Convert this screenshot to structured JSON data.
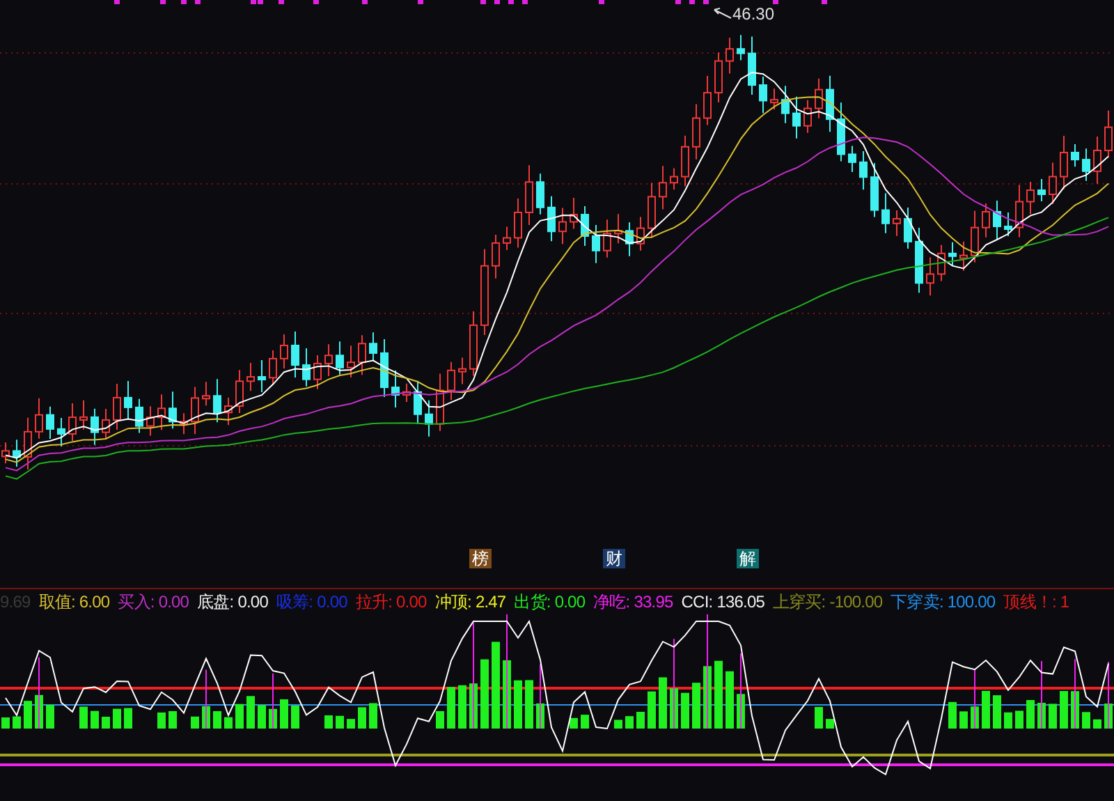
{
  "main_chart": {
    "high_label": "46.30"
  },
  "badges": [
    {
      "text": "榜",
      "color": "#7a4a1a"
    },
    {
      "text": "财",
      "color": "#1a3a6a"
    },
    {
      "text": "解",
      "color": "#0f6e6e"
    }
  ],
  "legend": [
    {
      "value": "9.69",
      "color": "#3a3a3a"
    },
    {
      "label": "取值:",
      "value": "6.00",
      "color": "#d8c030"
    },
    {
      "label": "买入:",
      "value": "0.00",
      "color": "#c030c8"
    },
    {
      "label": "底盘:",
      "value": "0.00",
      "color": "#f0f0f0"
    },
    {
      "label": "吸筹:",
      "value": "0.00",
      "color": "#1a2ee8"
    },
    {
      "label": "拉升:",
      "value": "0.00",
      "color": "#e81a1a"
    },
    {
      "label": "冲顶:",
      "value": "2.47",
      "color": "#f0f020"
    },
    {
      "label": "出货:",
      "value": "0.00",
      "color": "#20e820"
    },
    {
      "label": "净吃:",
      "value": "33.95",
      "color": "#f020f0"
    },
    {
      "label": "CCI:",
      "value": "136.05",
      "color": "#f0f0f0"
    },
    {
      "label": "上穿买:",
      "value": "-100.00",
      "color": "#8a8a20"
    },
    {
      "label": "下穿卖:",
      "value": "100.00",
      "color": "#2090f0"
    },
    {
      "label": "顶线！:",
      "value": "1",
      "color": "#e81a1a"
    }
  ]
}
